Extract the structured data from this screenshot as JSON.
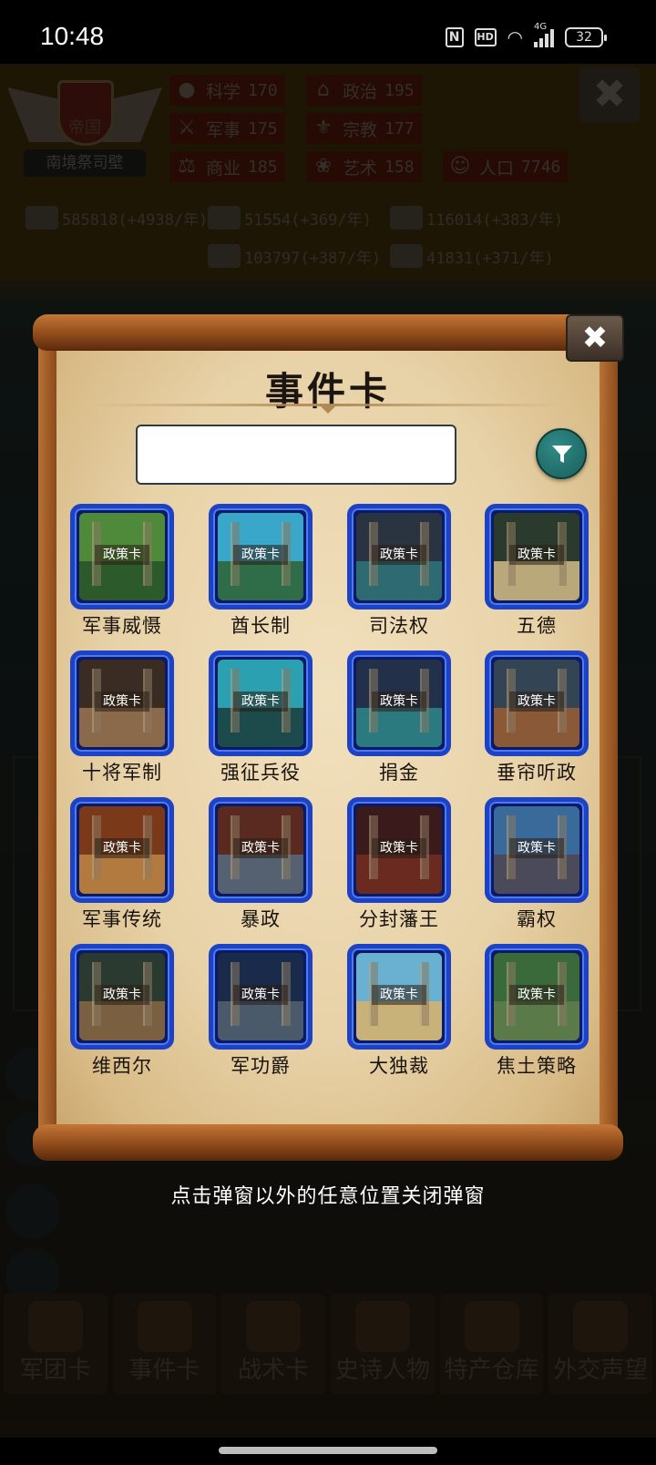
{
  "status_bar": {
    "time": "10:48",
    "nfc": "N",
    "hd": "HD",
    "network": "4G",
    "battery": "32"
  },
  "hud": {
    "emblem_text": "帝国",
    "title": "南境祭司壁",
    "stats": [
      {
        "label": "科学",
        "value": "170"
      },
      {
        "label": "政治",
        "value": "195"
      },
      {
        "label": "军事",
        "value": "175"
      },
      {
        "label": "宗教",
        "value": "177"
      },
      {
        "label": "商业",
        "value": "185"
      },
      {
        "label": "艺术",
        "value": "158"
      },
      {
        "label": "人口",
        "value": "7746"
      }
    ],
    "resources": [
      "585818(+4938/年)",
      "51554(+369/年)",
      "116014(+383/年)",
      "103797(+387/年)",
      "41831(+371/年)"
    ]
  },
  "bottom_nav": [
    "军团卡",
    "事件卡",
    "战术卡",
    "史诗人物",
    "特产仓库",
    "外交声望"
  ],
  "dialog": {
    "title": "事件卡",
    "search_value": "",
    "search_placeholder": "",
    "card_tag": "政策卡",
    "cards": [
      {
        "name": "军事威慑",
        "colors": [
          "#4f8a3a",
          "#2d5a2a"
        ]
      },
      {
        "name": "酋长制",
        "colors": [
          "#39a7c9",
          "#2f6d48"
        ]
      },
      {
        "name": "司法权",
        "colors": [
          "#2a3440",
          "#2d6a72"
        ]
      },
      {
        "name": "五德",
        "colors": [
          "#2a3a2c",
          "#b9a97a"
        ]
      },
      {
        "name": "十将军制",
        "colors": [
          "#3a2c22",
          "#8a6a4a"
        ]
      },
      {
        "name": "强征兵役",
        "colors": [
          "#2aa0b0",
          "#1d4a4a"
        ]
      },
      {
        "name": "捐金",
        "colors": [
          "#23304a",
          "#2a7a80"
        ]
      },
      {
        "name": "垂帘听政",
        "colors": [
          "#334455",
          "#8a5a38"
        ]
      },
      {
        "name": "军事传统",
        "colors": [
          "#7a3a1a",
          "#b37a40"
        ]
      },
      {
        "name": "暴政",
        "colors": [
          "#5a2a20",
          "#556070"
        ]
      },
      {
        "name": "分封藩王",
        "colors": [
          "#3a1a1a",
          "#6a2a20"
        ]
      },
      {
        "name": "霸权",
        "colors": [
          "#3a6a9a",
          "#4a4a5a"
        ]
      },
      {
        "name": "维西尔",
        "colors": [
          "#2a3a30",
          "#7a6040"
        ]
      },
      {
        "name": "军功爵",
        "colors": [
          "#1a2a4a",
          "#4a5a6a"
        ]
      },
      {
        "name": "大独裁",
        "colors": [
          "#6ab0d0",
          "#c9b27a"
        ]
      },
      {
        "name": "焦土策略",
        "colors": [
          "#3a6a3a",
          "#5a7a4a"
        ]
      }
    ]
  },
  "hint": "点击弹窗以外的任意位置关闭弹窗",
  "colors": {
    "card_border": "#1d42c6",
    "filter": "#1f6b68",
    "parchment": "#ecd9b2"
  }
}
